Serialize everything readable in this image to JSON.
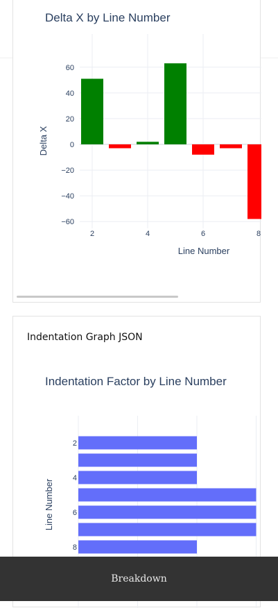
{
  "delta_chart": {
    "title": "Delta X by Line Number",
    "xlabel": "Line Number",
    "ylabel": "Delta X"
  },
  "indent_section": {
    "label": "Indentation Graph JSON"
  },
  "indent_chart": {
    "title": "Indentation Factor by Line Number",
    "ylabel": "Line Number"
  },
  "footer": {
    "breakdown_label": "Breakdown"
  },
  "colors": {
    "positive": "#008000",
    "negative": "#ff0000",
    "bar": "#636efa",
    "axis_text": "#2a3f5f",
    "grid": "#ebeef3",
    "footer_bg": "#333333"
  },
  "chart_data": [
    {
      "type": "bar",
      "title": "Delta X by Line Number",
      "xlabel": "Line Number",
      "ylabel": "Delta X",
      "x": [
        2,
        3,
        4,
        5,
        6,
        7,
        8
      ],
      "values": [
        51,
        -3,
        2,
        63,
        -8,
        -3,
        -58
      ],
      "ylim": [
        -65,
        70
      ],
      "yticks": [
        60,
        40,
        20,
        0,
        -20,
        -40,
        -60
      ],
      "xticks": [
        2,
        4,
        6,
        8
      ],
      "grid": true,
      "colors_by_sign": {
        "positive": "#008000",
        "negative": "#ff0000"
      }
    },
    {
      "type": "bar",
      "orientation": "horizontal",
      "title": "Indentation Factor by Line Number",
      "ylabel": "Line Number",
      "categories": [
        2,
        3,
        4,
        5,
        6,
        7,
        8
      ],
      "values": [
        2,
        2,
        2,
        3,
        3,
        3,
        2
      ],
      "yticks": [
        2,
        4,
        6,
        8
      ],
      "grid": true
    }
  ]
}
